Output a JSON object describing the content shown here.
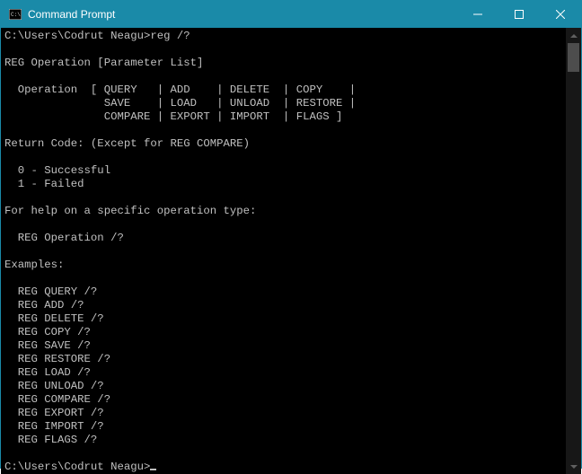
{
  "window": {
    "title": "Command Prompt"
  },
  "prompt1": "C:\\Users\\Codrut Neagu>",
  "command1": "reg /?",
  "output": {
    "l1": "REG Operation [Parameter List]",
    "l2": "  Operation  [ QUERY   | ADD    | DELETE  | COPY    |",
    "l3": "               SAVE    | LOAD   | UNLOAD  | RESTORE |",
    "l4": "               COMPARE | EXPORT | IMPORT  | FLAGS ]",
    "l5": "Return Code: (Except for REG COMPARE)",
    "l6": "  0 - Successful",
    "l7": "  1 - Failed",
    "l8": "For help on a specific operation type:",
    "l9": "  REG Operation /?",
    "l10": "Examples:",
    "ex": [
      "  REG QUERY /?",
      "  REG ADD /?",
      "  REG DELETE /?",
      "  REG COPY /?",
      "  REG SAVE /?",
      "  REG RESTORE /?",
      "  REG LOAD /?",
      "  REG UNLOAD /?",
      "  REG COMPARE /?",
      "  REG EXPORT /?",
      "  REG IMPORT /?",
      "  REG FLAGS /?"
    ]
  },
  "prompt2": "C:\\Users\\Codrut Neagu>"
}
